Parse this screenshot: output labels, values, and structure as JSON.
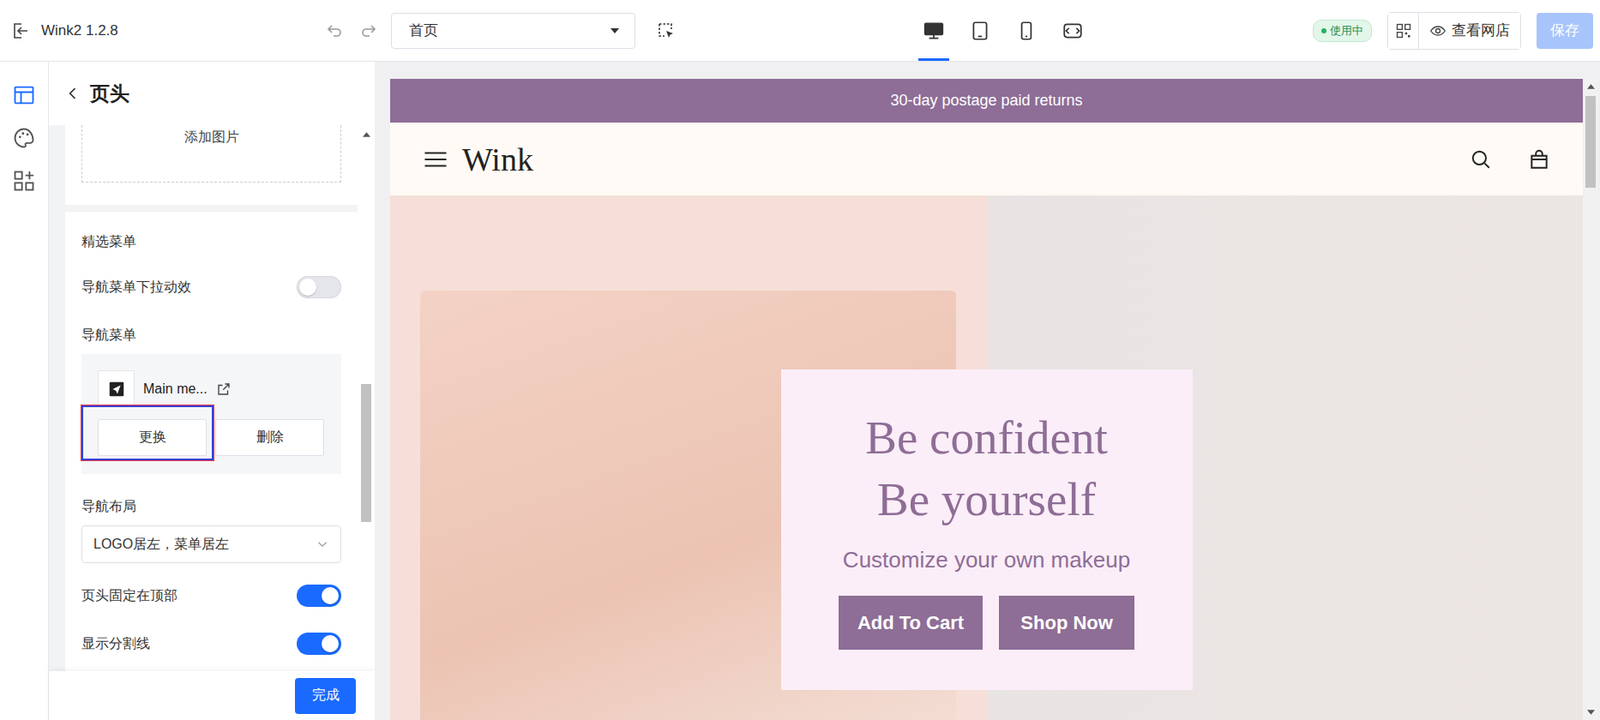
{
  "topbar": {
    "title": "Wink2 1.2.8",
    "page_select": "首页",
    "devices": [
      {
        "kind": "desktop",
        "selected": true
      },
      {
        "kind": "tablet",
        "selected": false
      },
      {
        "kind": "phone",
        "selected": false
      },
      {
        "kind": "fit",
        "selected": false
      }
    ],
    "status_badge": "使用中",
    "view_store": "查看网店",
    "save": {
      "label": "保存",
      "disabled": true
    }
  },
  "rail": [
    {
      "kind": "layout",
      "selected": true
    },
    {
      "kind": "theme",
      "selected": false
    },
    {
      "kind": "apps",
      "selected": false
    }
  ],
  "panel": {
    "title": "页头",
    "image_upload": "添加图片",
    "section_title": "精选菜单",
    "fields": [
      {
        "kind": "toggle",
        "label": "导航菜单下拉动效",
        "on": false
      },
      {
        "kind": "menu",
        "label": "导航菜单",
        "item": "Main me...",
        "buttons": [
          {
            "label": "更换",
            "focused": true
          },
          {
            "label": "删除",
            "focused": false
          }
        ]
      },
      {
        "kind": "select",
        "label": "导航布局",
        "value": "LOGO居左，菜单居左"
      },
      {
        "kind": "toggle",
        "label": "页头固定在顶部",
        "on": true
      },
      {
        "kind": "toggle",
        "label": "显示分割线",
        "on": true
      }
    ],
    "done_button": "完成"
  },
  "preview": {
    "announcement": "30-day postage paid returns",
    "logo": "Wink",
    "hero": {
      "title_lines": [
        "Be confident",
        "Be yourself"
      ],
      "subtitle": "Customize your own makeup",
      "buttons": [
        "Add To Cart",
        "Shop Now"
      ]
    }
  }
}
